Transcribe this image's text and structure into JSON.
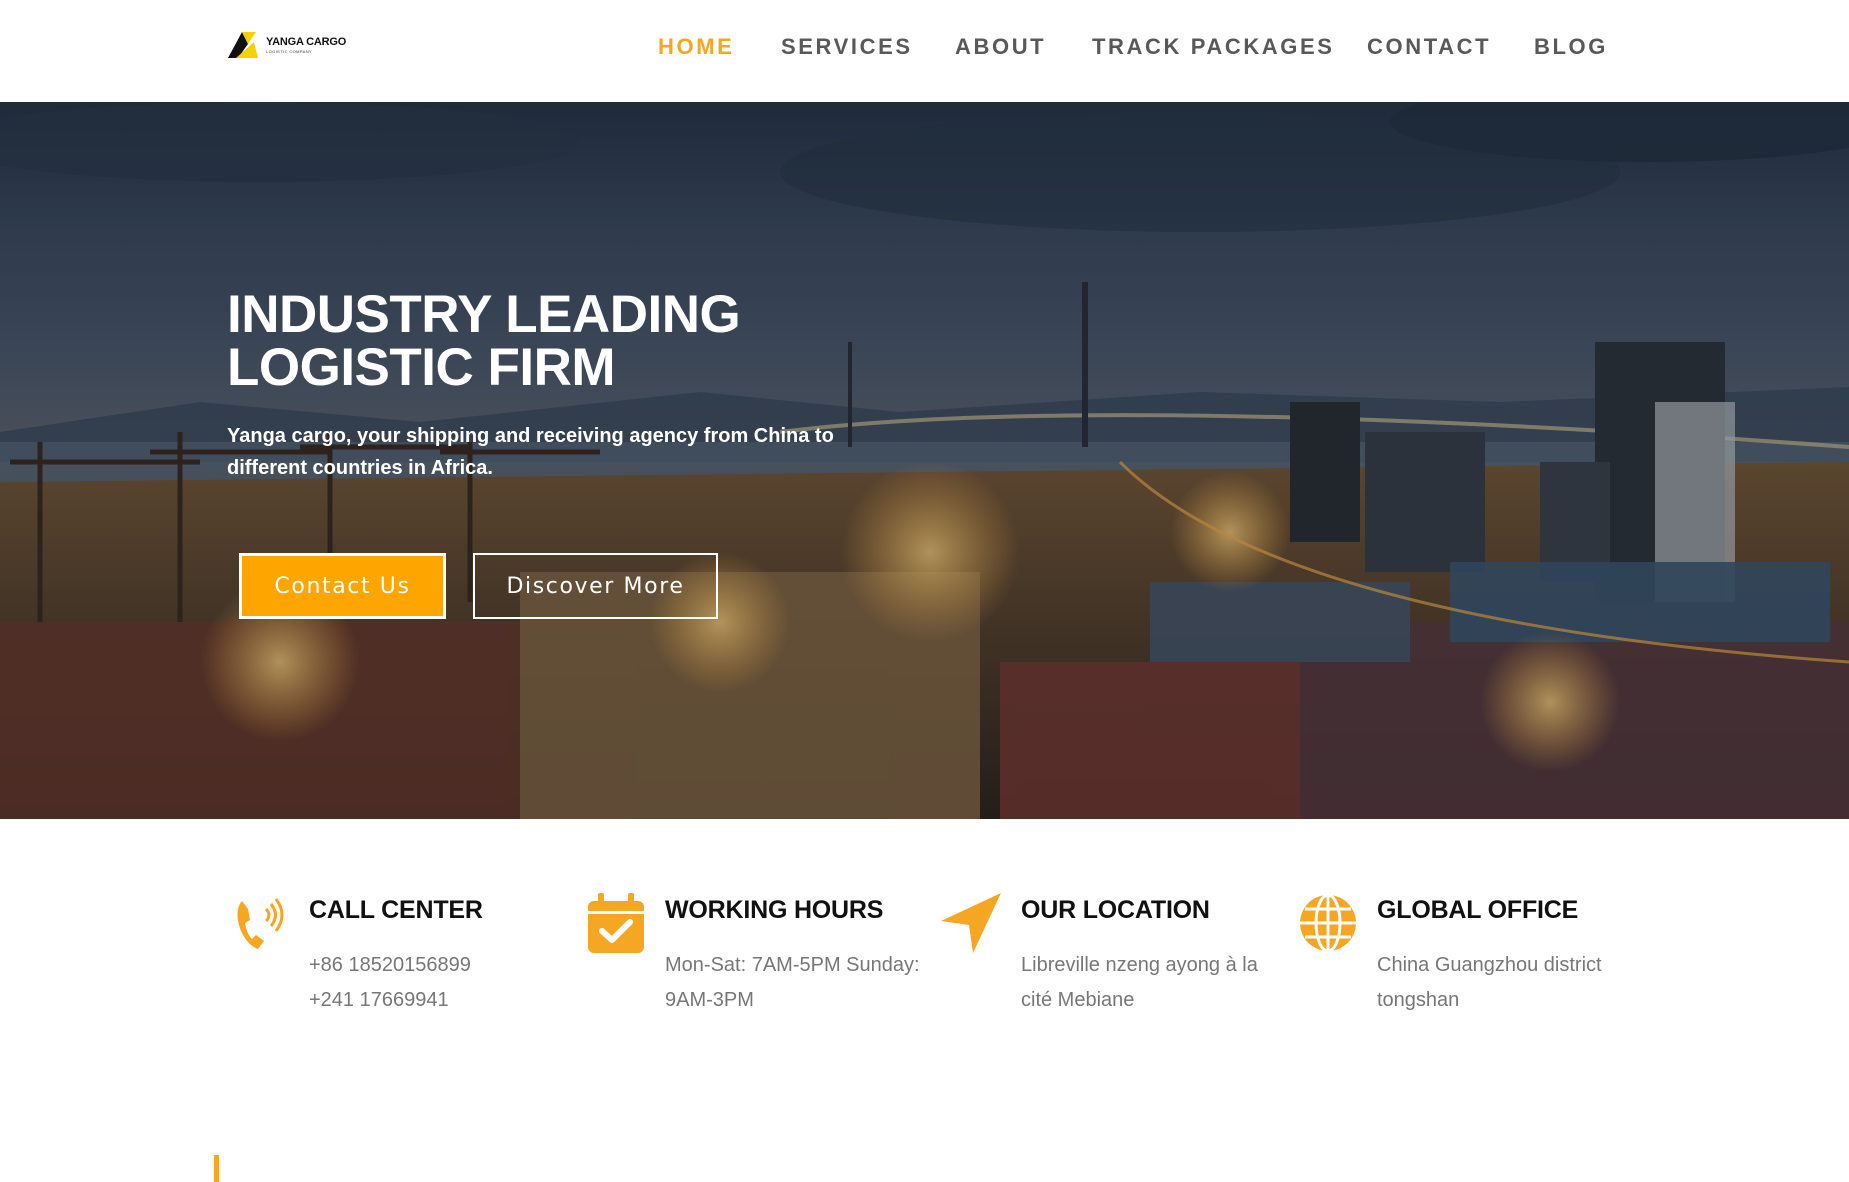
{
  "brand": {
    "name": "YANGA CARGO",
    "tagline": "LOGISTIC COMPANY",
    "accent": "#f5a623",
    "button_color": "#ffa500"
  },
  "nav": {
    "items": [
      {
        "label": "HOME",
        "active": true
      },
      {
        "label": "SERVICES",
        "active": false
      },
      {
        "label": "ABOUT",
        "active": false
      },
      {
        "label": "TRACK PACKAGES",
        "active": false
      },
      {
        "label": "CONTACT",
        "active": false
      },
      {
        "label": "BLOG",
        "active": false
      }
    ]
  },
  "hero": {
    "title_line1": "INDUSTRY LEADING",
    "title_line2": "LOGISTIC FIRM",
    "subtitle": "Yanga cargo,  your shipping and receiving agency from China to different countries in Africa.",
    "primary_button": "Contact Us",
    "secondary_button": "Discover More"
  },
  "info": [
    {
      "icon": "phone-icon",
      "title": "CALL CENTER",
      "lines": [
        "+86 18520156899",
        "+241 17669941"
      ]
    },
    {
      "icon": "calendar-check-icon",
      "title": "WORKING HOURS",
      "lines": [
        "Mon-Sat: 7AM-5PM Sunday:",
        "9AM-3PM"
      ]
    },
    {
      "icon": "location-arrow-icon",
      "title": "OUR LOCATION",
      "lines": [
        "Libreville nzeng ayong à la",
        "cité Mebiane"
      ]
    },
    {
      "icon": "globe-icon",
      "title": "GLOBAL OFFICE",
      "lines": [
        "China Guangzhou district",
        "tongshan"
      ]
    }
  ]
}
